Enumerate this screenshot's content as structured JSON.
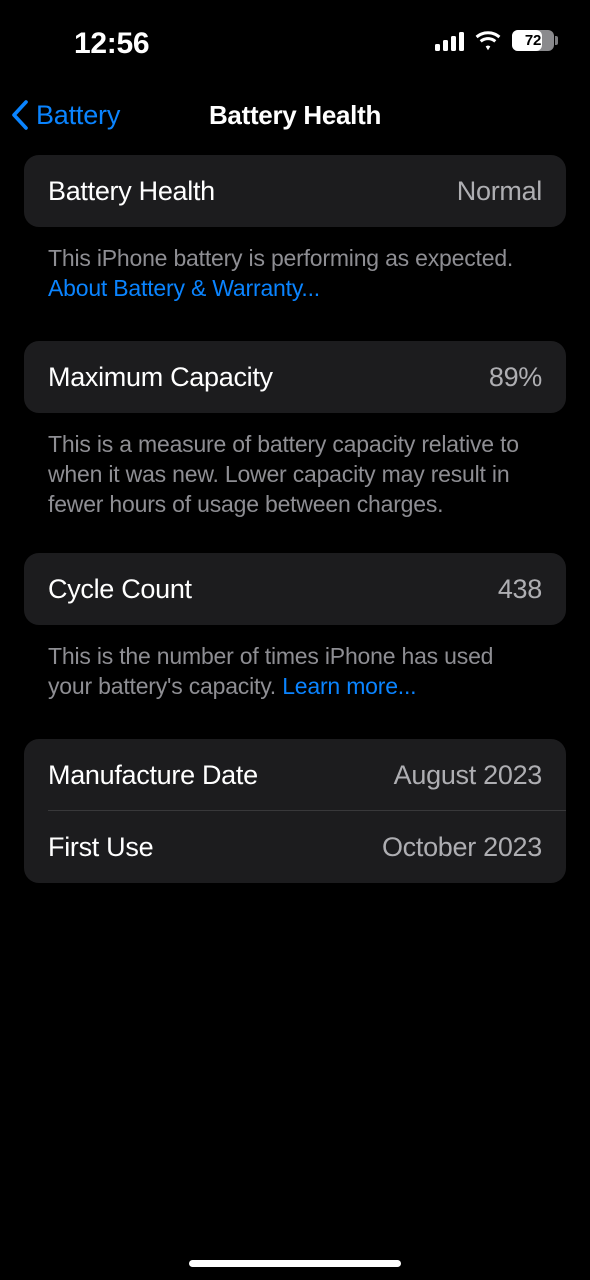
{
  "status_bar": {
    "time": "12:56",
    "cellular_icon": "cellular-bars-icon",
    "wifi_icon": "wifi-icon",
    "battery_icon": "battery-icon",
    "battery_percent": "72",
    "battery_level": 72
  },
  "nav": {
    "back_label": "Battery",
    "back_icon": "chevron-left-icon",
    "title": "Battery Health"
  },
  "colors": {
    "accent_blue": "#0A84FF",
    "card_background": "#1C1C1E",
    "page_background": "#000000",
    "primary_text": "#FFFFFF",
    "secondary_text": "#AEAEB2",
    "footnote_text": "#8E8E93",
    "separator": "#38383A"
  },
  "sections": {
    "battery_health": {
      "row_label": "Battery Health",
      "row_value": "Normal",
      "footnote_text": "This iPhone battery is performing as expected. ",
      "footnote_link": "About Battery & Warranty..."
    },
    "maximum_capacity": {
      "row_label": "Maximum Capacity",
      "row_value": "89%",
      "footnote_text": "This is a measure of battery capacity relative to when it was new. Lower capacity may result in fewer hours of usage between charges."
    },
    "cycle_count": {
      "row_label": "Cycle Count",
      "row_value": "438",
      "footnote_text": "This is the number of times iPhone has used your battery's capacity. ",
      "footnote_link": "Learn more..."
    },
    "dates": {
      "manufacture_date_label": "Manufacture Date",
      "manufacture_date_value": "August 2023",
      "first_use_label": "First Use",
      "first_use_value": "October 2023"
    }
  }
}
